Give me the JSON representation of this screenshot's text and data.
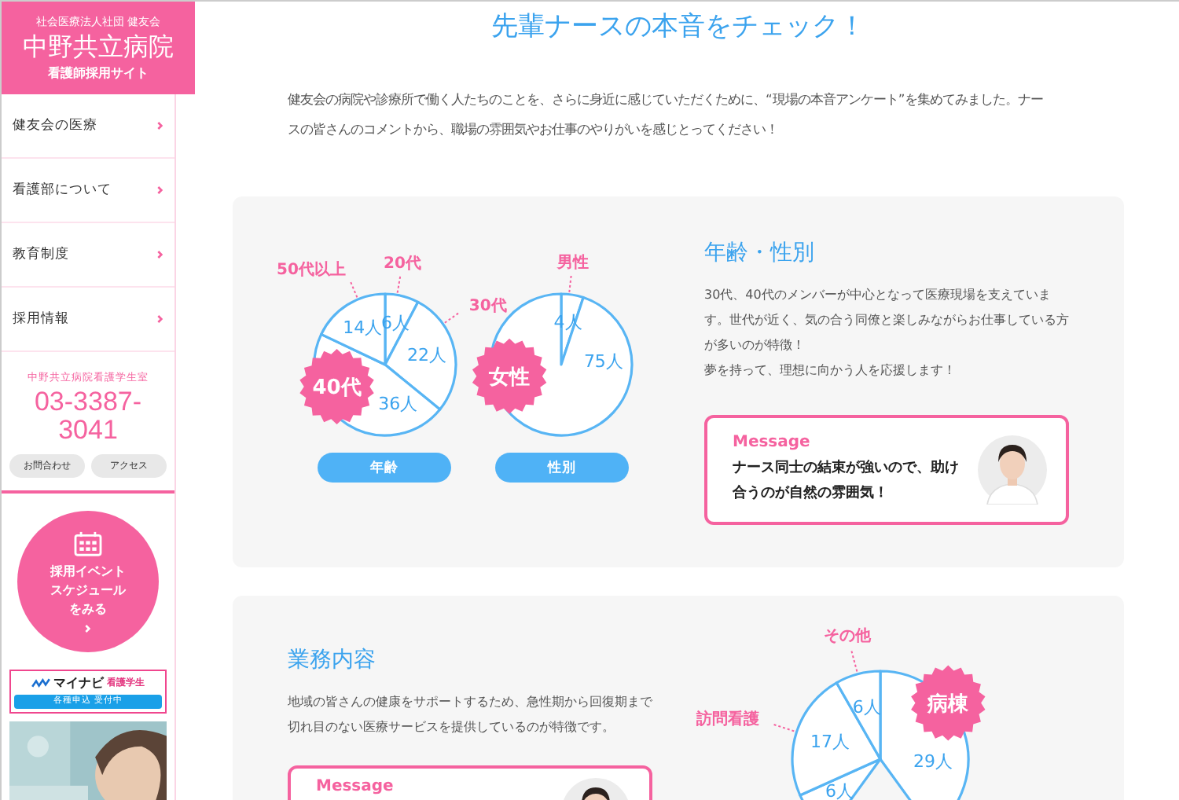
{
  "sidebar": {
    "header": {
      "org": "社会医療法人社団 健友会",
      "name": "中野共立病院",
      "subtitle": "看護師採用サイト"
    },
    "nav": [
      {
        "label": "健友会の医療"
      },
      {
        "label": "看護部について"
      },
      {
        "label": "教育制度"
      },
      {
        "label": "採用情報"
      }
    ],
    "contact": {
      "label": "中野共立病院看護学生室",
      "phone": "03-3387-3041",
      "buttons": [
        "お問合わせ",
        "アクセス"
      ]
    },
    "event_button": "採用イベントスケジュールをみる",
    "banner": {
      "logo": "マイナビ",
      "tag": "看護学生",
      "bar": "各種申込 受付中"
    }
  },
  "main": {
    "title": "先輩ナースの本音をチェック！",
    "intro": "健友会の病院や診療所で働く人たちのことを、さらに身近に感じていただくために、“現場の本音アンケート”を集めてみました。ナースの皆さんのコメントから、職場の雰囲気やお仕事のやりがいを感じとってください！",
    "sections": [
      {
        "kind": "charts-left",
        "heading": "年齢・性別",
        "paragraphs": [
          "30代、40代のメンバーが中心となって医療現場を支えています。世代が近く、気の合う同僚と楽しみながらお仕事している方が多いのが特徴！",
          "夢を持って、理想に向かう人を応援します！"
        ],
        "message": {
          "label": "Message",
          "text": "ナース同士の結束が強いので、助け合うのが自然の雰囲気！"
        },
        "charts": [
          {
            "button": "年齢",
            "chart_data": {
              "type": "pie",
              "categories": [
                "20代",
                "30代",
                "40代",
                "50代以上"
              ],
              "values": [
                6,
                22,
                36,
                14
              ],
              "data_labels": true,
              "value_labels": [
                "6人",
                "22人",
                "36人",
                "14人"
              ]
            }
          },
          {
            "button": "性別",
            "chart_data": {
              "type": "pie",
              "categories": [
                "男性",
                "女性"
              ],
              "values": [
                4,
                75
              ],
              "data_labels": true,
              "value_labels": [
                "4人",
                "75人"
              ]
            }
          }
        ]
      },
      {
        "kind": "charts-right",
        "heading": "業務内容",
        "paragraphs": [
          "地域の皆さんの健康をサポートするため、急性期から回復期まで切れ目のない医療サービスを提供しているのが特徴です。"
        ],
        "message": {
          "label": "Message"
        },
        "charts": [
          {
            "chart_data": {
              "type": "pie",
              "categories": [
                "病棟",
                null,
                null,
                "訪問看護",
                "その他"
              ],
              "values": [
                29,
                null,
                6,
                17,
                6
              ],
              "data_labels": true,
              "value_labels": [
                "29人",
                null,
                "6人",
                "17人",
                "6人"
              ]
            }
          }
        ]
      }
    ]
  }
}
